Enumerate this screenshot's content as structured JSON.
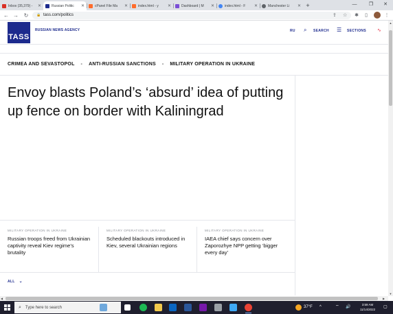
{
  "browser": {
    "tabs": [
      {
        "title": "Inbox (35,379) -",
        "color": "#d93025",
        "active": false
      },
      {
        "title": "Russian Politic",
        "color": "#1c2a8d",
        "active": true
      },
      {
        "title": "cPanel File Ma",
        "color": "#ff6c2c",
        "active": false
      },
      {
        "title": "index.html - y",
        "color": "#ff6c2c",
        "active": false
      },
      {
        "title": "Dashboard | M",
        "color": "#7b4fd6",
        "active": false
      },
      {
        "title": "index.html - F",
        "color": "#4285f4",
        "active": false
      },
      {
        "title": "Manchester Li",
        "color": "#5f6368",
        "active": false
      }
    ],
    "new_tab": "+",
    "url": "tass.com/politics",
    "win_min": "—",
    "win_max": "❐",
    "win_close": "✕",
    "back": "←",
    "forward": "→",
    "reload": "↻",
    "lock": "🔒",
    "share": "⇪",
    "star": "☆",
    "extensions": "✱",
    "sidepanel": "▯",
    "menu": "⋮"
  },
  "site": {
    "logo": "TASS",
    "agency": "RUSSIAN NEWS AGENCY",
    "lang": "RU",
    "search_icon": "⌕",
    "search": "SEARCH",
    "sections_icon": "☰",
    "sections": "SECTIONS",
    "wave": "∿"
  },
  "topics": {
    "items": [
      "CRIMEA AND SEVASTOPOL",
      "ANTI-RUSSIAN SANCTIONS",
      "MILITARY OPERATION IN UKRAINE"
    ],
    "dash": "-"
  },
  "article": {
    "headline": "Envoy blasts Poland’s ‘absurd’ idea of putting up fence on border with Kaliningrad"
  },
  "cards": [
    {
      "tag": "MILITARY OPERATION IN UKRAINE",
      "title": "Russian troops freed from Ukrainian captivity reveal Kiev regime’s brutality"
    },
    {
      "tag": "MILITARY OPERATION IN UKRAINE",
      "title": "Scheduled blackouts introduced in Kiev, several Ukrainian regions"
    },
    {
      "tag": "MILITARY OPERATION IN UKRAINE",
      "title": "IAEA chief says concern over Zaporozhye NPP getting ‘bigger every day’"
    }
  ],
  "all_button": {
    "label": "ALL",
    "chevron": "⌄"
  },
  "scroll": {
    "up": "▲",
    "down": "▼",
    "left": "◀",
    "right": "▶"
  },
  "taskbar": {
    "search_icon": "⌕",
    "search_placeholder": "Type here to search",
    "weather": "37°F",
    "tray_caret": "^",
    "wifi": "⌔",
    "volume": "🔊",
    "time": "3:59 AM",
    "date": "11/14/2022",
    "notification": "▢"
  }
}
